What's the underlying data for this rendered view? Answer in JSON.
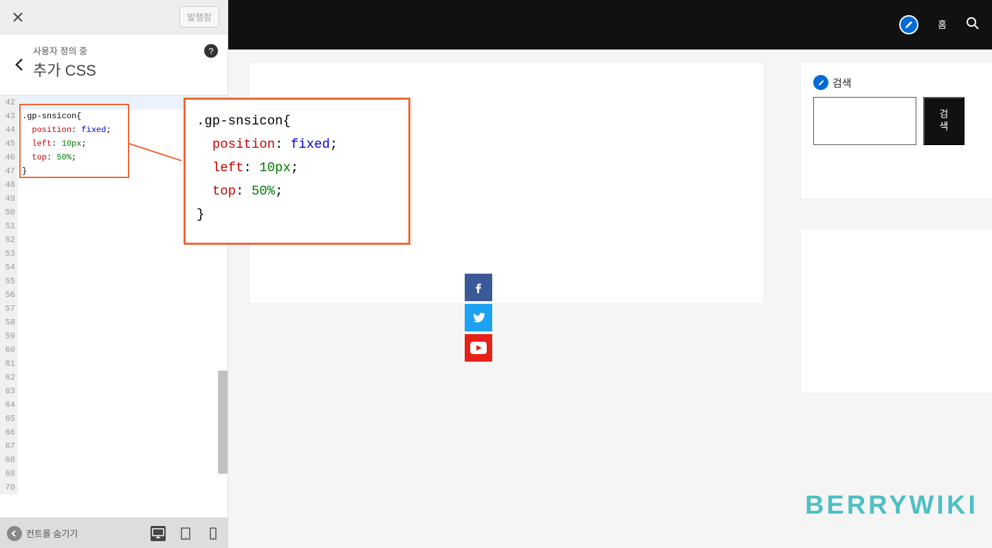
{
  "sidebar": {
    "publish_label": "발행함",
    "header_sub": "사용자 정의 중",
    "header_title": "추가 CSS",
    "collapse_label": "컨트롤 숨기기"
  },
  "editor": {
    "lines": [
      {
        "num": "42",
        "content": ""
      },
      {
        "num": "43",
        "content": ".gp-snsicon{",
        "cls": "sel"
      },
      {
        "num": "44",
        "content": "  position: fixed;",
        "prop": "position",
        "val": "fixed"
      },
      {
        "num": "45",
        "content": "  left: 10px;",
        "prop": "left",
        "val": "10px"
      },
      {
        "num": "46",
        "content": "  top: 50%;",
        "prop": "top",
        "val": "50%"
      },
      {
        "num": "47",
        "content": "}",
        "cls": "sel"
      },
      {
        "num": "48",
        "content": ""
      },
      {
        "num": "49",
        "content": ""
      },
      {
        "num": "50",
        "content": ""
      },
      {
        "num": "51",
        "content": ""
      },
      {
        "num": "52",
        "content": ""
      },
      {
        "num": "53",
        "content": ""
      },
      {
        "num": "54",
        "content": ""
      },
      {
        "num": "55",
        "content": ""
      },
      {
        "num": "56",
        "content": ""
      },
      {
        "num": "57",
        "content": ""
      },
      {
        "num": "58",
        "content": ""
      },
      {
        "num": "59",
        "content": ""
      },
      {
        "num": "60",
        "content": ""
      },
      {
        "num": "61",
        "content": ""
      },
      {
        "num": "62",
        "content": ""
      },
      {
        "num": "63",
        "content": ""
      },
      {
        "num": "64",
        "content": ""
      },
      {
        "num": "65",
        "content": ""
      },
      {
        "num": "66",
        "content": ""
      },
      {
        "num": "67",
        "content": ""
      },
      {
        "num": "68",
        "content": ""
      },
      {
        "num": "69",
        "content": ""
      },
      {
        "num": "70",
        "content": ""
      }
    ]
  },
  "callout": {
    "l1_sel": ".gp-snsicon{",
    "l2_prop": "position",
    "l2_val": "fixed",
    "l3_prop": "left",
    "l3_val": "10px",
    "l4_prop": "top",
    "l4_val": "50%",
    "l5": "}"
  },
  "preview": {
    "home_label": "홈",
    "search_widget_label": "검색",
    "search_button_label": "검색"
  },
  "brand": "BERRYWIKI"
}
